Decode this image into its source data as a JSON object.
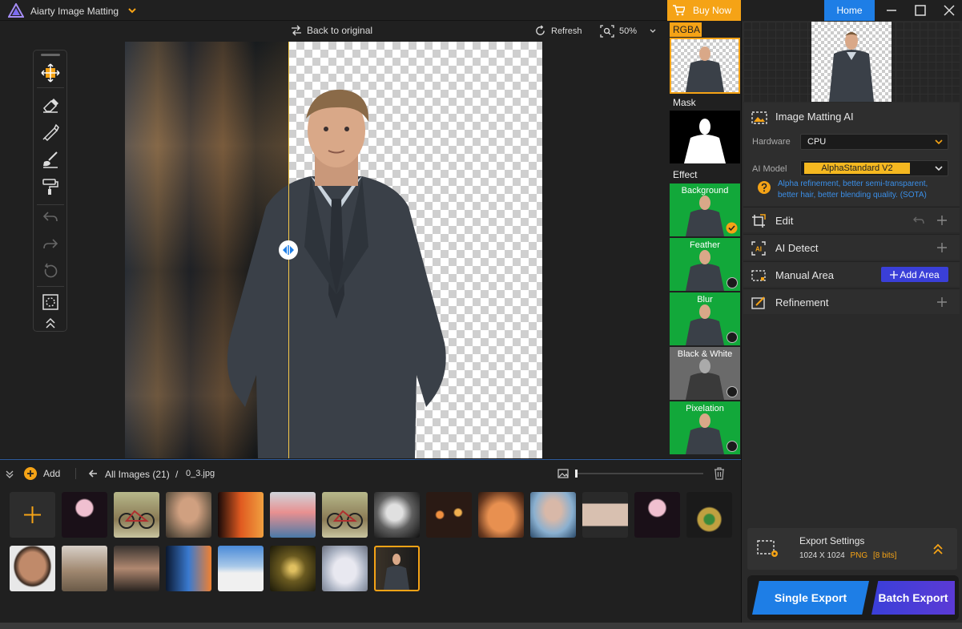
{
  "app": {
    "title": "Aiarty Image Matting"
  },
  "topbar": {
    "buy_now": "Buy Now",
    "home": "Home"
  },
  "canvas_toolbar": {
    "back_to_original": "Back to original",
    "refresh": "Refresh",
    "zoom": "50%"
  },
  "views": {
    "rgba": "RGBA",
    "mask": "Mask",
    "effect": "Effect"
  },
  "effects": [
    {
      "label": "Background",
      "selected": true
    },
    {
      "label": "Feather",
      "selected": false
    },
    {
      "label": "Blur",
      "selected": false
    },
    {
      "label": "Black & White",
      "selected": false
    },
    {
      "label": "Pixelation",
      "selected": false
    }
  ],
  "filebar": {
    "add": "Add",
    "all_images": "All Images (21)",
    "separator": "/",
    "current_file": "0_3.jpg"
  },
  "panel": {
    "matting": {
      "title": "Image Matting AI",
      "hardware_label": "Hardware",
      "hardware_value": "CPU",
      "model_label": "AI Model",
      "model_value": "AlphaStandard  V2",
      "model_desc": "Alpha refinement, better semi-transparent, better hair, better blending quality. (SOTA)"
    },
    "edit": "Edit",
    "ai_detect": "AI Detect",
    "manual_area": "Manual Area",
    "add_area": "Add Area",
    "refinement": "Refinement",
    "export": {
      "title": "Export Settings",
      "size": "1024 X 1024",
      "format": "PNG",
      "bits": "[8 bits]"
    },
    "single_export": "Single Export",
    "batch_export": "Batch Export"
  },
  "colors": {
    "accent": "#f5a316",
    "blue": "#1e7ee6",
    "green": "#12a83a",
    "purple": "#3a3fd8"
  }
}
